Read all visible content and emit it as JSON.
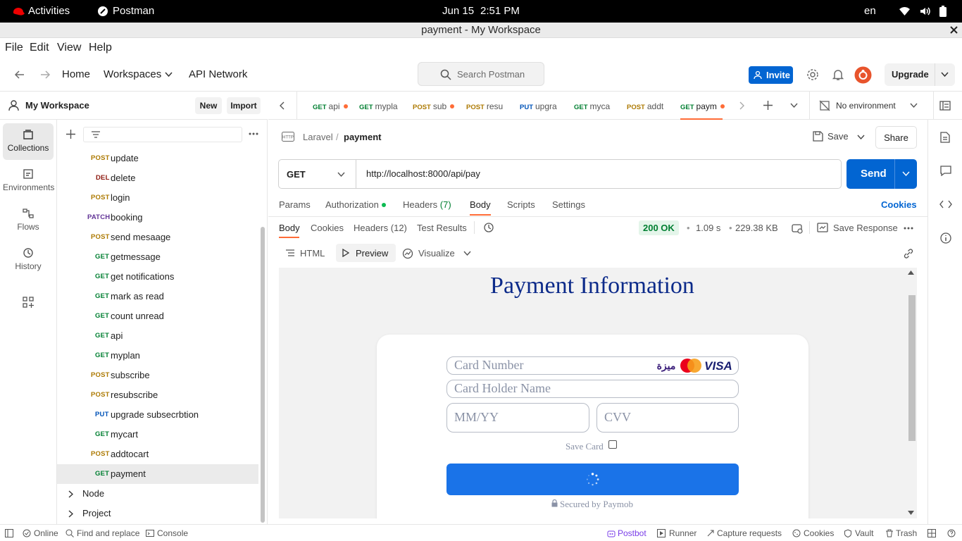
{
  "system": {
    "activities": "Activities",
    "app_name": "Postman",
    "date": "Jun 15",
    "time": "2:51 PM",
    "lang": "en"
  },
  "window": {
    "title": "payment - My Workspace"
  },
  "menu": [
    "File",
    "Edit",
    "View",
    "Help"
  ],
  "header": {
    "home": "Home",
    "workspaces": "Workspaces",
    "api_network": "API Network",
    "search_placeholder": "Search Postman",
    "invite": "Invite",
    "upgrade": "Upgrade"
  },
  "sidebar": {
    "workspace_name": "My Workspace",
    "new": "New",
    "import": "Import",
    "rail": [
      {
        "label": "Collections",
        "icon": "collections-icon"
      },
      {
        "label": "Environments",
        "icon": "environments-icon"
      },
      {
        "label": "Flows",
        "icon": "flows-icon"
      },
      {
        "label": "History",
        "icon": "history-icon"
      }
    ],
    "items": [
      {
        "method": "POST",
        "name": "update"
      },
      {
        "method": "DEL",
        "name": "delete"
      },
      {
        "method": "POST",
        "name": "login"
      },
      {
        "method": "PATCH",
        "name": "booking"
      },
      {
        "method": "POST",
        "name": "send mesaage"
      },
      {
        "method": "GET",
        "name": "getmessage"
      },
      {
        "method": "GET",
        "name": "get notifications"
      },
      {
        "method": "GET",
        "name": "mark as read"
      },
      {
        "method": "GET",
        "name": "count unread"
      },
      {
        "method": "GET",
        "name": "api"
      },
      {
        "method": "GET",
        "name": "myplan"
      },
      {
        "method": "POST",
        "name": "subscribe"
      },
      {
        "method": "POST",
        "name": "resubscribe"
      },
      {
        "method": "PUT",
        "name": "upgrade subsecrbtion"
      },
      {
        "method": "GET",
        "name": "mycart"
      },
      {
        "method": "POST",
        "name": "addtocart"
      },
      {
        "method": "GET",
        "name": "payment"
      }
    ],
    "folders": [
      "Node",
      "Project"
    ]
  },
  "tabs": [
    {
      "method": "GET",
      "name": "api",
      "dirty": true
    },
    {
      "method": "GET",
      "name": "mypla",
      "dirty": false
    },
    {
      "method": "POST",
      "name": "sub",
      "dirty": true
    },
    {
      "method": "POST",
      "name": "resu",
      "dirty": false
    },
    {
      "method": "PUT",
      "name": "upgra",
      "dirty": false
    },
    {
      "method": "GET",
      "name": "myca",
      "dirty": false
    },
    {
      "method": "POST",
      "name": "addt",
      "dirty": false
    },
    {
      "method": "GET",
      "name": "paym",
      "dirty": true
    }
  ],
  "environment": "No environment",
  "request": {
    "breadcrumb_parent": "Laravel",
    "breadcrumb_sep": "/",
    "name": "payment",
    "save": "Save",
    "share": "Share",
    "method": "GET",
    "url": "http://localhost:8000/api/pay",
    "send": "Send",
    "tabs": {
      "params": "Params",
      "authorization": "Authorization",
      "headers": "Headers",
      "headers_count": "(7)",
      "body": "Body",
      "scripts": "Scripts",
      "settings": "Settings",
      "cookies": "Cookies"
    }
  },
  "response": {
    "tabs": {
      "body": "Body",
      "cookies": "Cookies",
      "headers": "Headers",
      "headers_count": "(12)",
      "test_results": "Test Results"
    },
    "status": "200 OK",
    "time": "1.09 s",
    "size": "229.38 KB",
    "save_response": "Save Response",
    "views": {
      "html": "HTML",
      "preview": "Preview",
      "visualize": "Visualize"
    }
  },
  "page": {
    "heading": "Payment Information",
    "card_number": "Card Number",
    "card_holder": "Card Holder Name",
    "expiry": "MM/YY",
    "cvv": "CVV",
    "save_card": "Save Card",
    "secured": "Secured by Paymob",
    "meeza_text": "ميزة"
  },
  "footer": {
    "online": "Online",
    "find_replace": "Find and replace",
    "console": "Console",
    "postbot": "Postbot",
    "runner": "Runner",
    "capture": "Capture requests",
    "cookies": "Cookies",
    "vault": "Vault",
    "trash": "Trash"
  },
  "colors": {
    "accent": "#0265d2",
    "orange": "#ff6c37",
    "get": "#007f31",
    "post": "#ad7a03",
    "put": "#0053b8",
    "del": "#8e1a10",
    "patch": "#623497",
    "heading": "#0d2b8a",
    "pay_button": "#1a73e8"
  }
}
